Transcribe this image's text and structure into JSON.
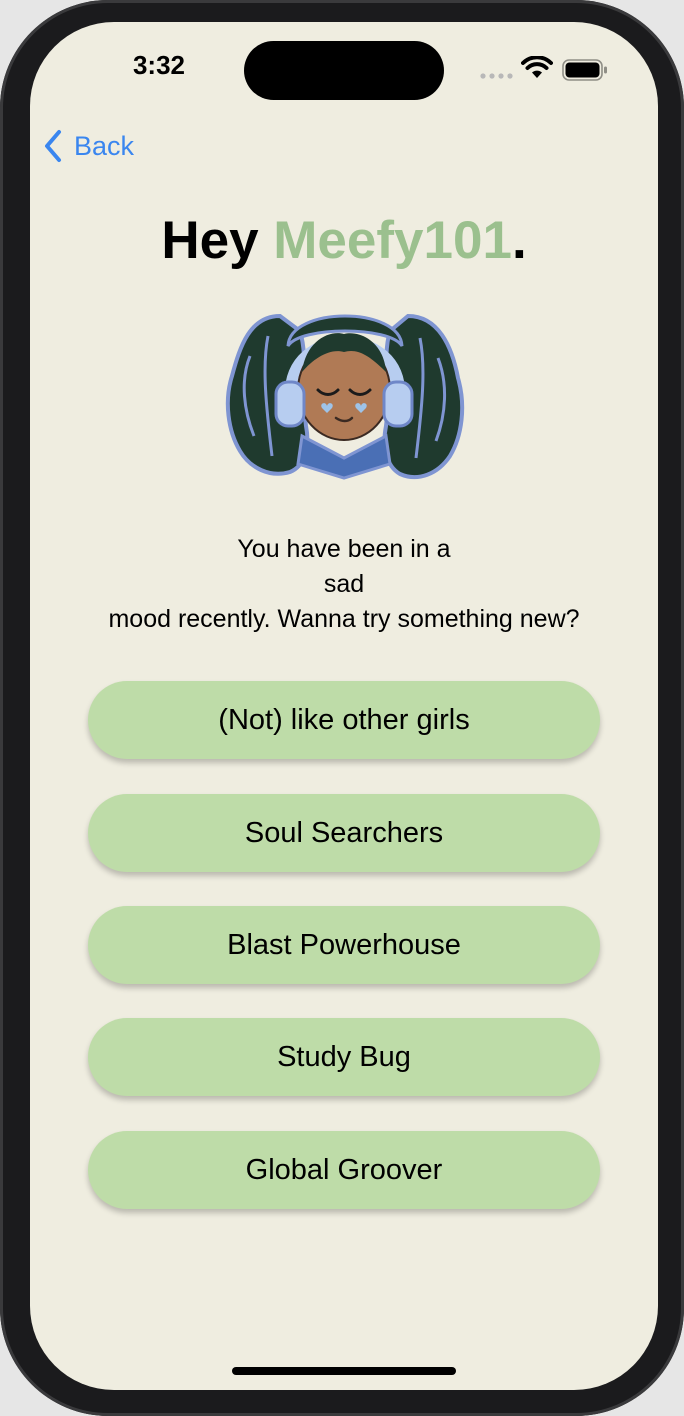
{
  "status_bar": {
    "time": "3:32"
  },
  "nav": {
    "back_label": "Back"
  },
  "greeting": {
    "prefix": "Hey ",
    "username": "Meefy101",
    "suffix": "."
  },
  "mood_message": {
    "line1": "You have been in a",
    "mood": "sad",
    "line3": "mood recently. Wanna try something new?"
  },
  "options": [
    {
      "label": "(Not) like other girls"
    },
    {
      "label": "Soul Searchers"
    },
    {
      "label": "Blast Powerhouse"
    },
    {
      "label": "Study Bug"
    },
    {
      "label": "Global Groover"
    }
  ],
  "colors": {
    "background": "#efede0",
    "accent_username": "#9bc08e",
    "button_fill": "#bedca8",
    "link_blue": "#3a86ef"
  },
  "icons": {
    "back": "chevron-left-icon",
    "wifi": "wifi-icon",
    "battery": "battery-icon",
    "signal": "cellular-signal-icon"
  }
}
